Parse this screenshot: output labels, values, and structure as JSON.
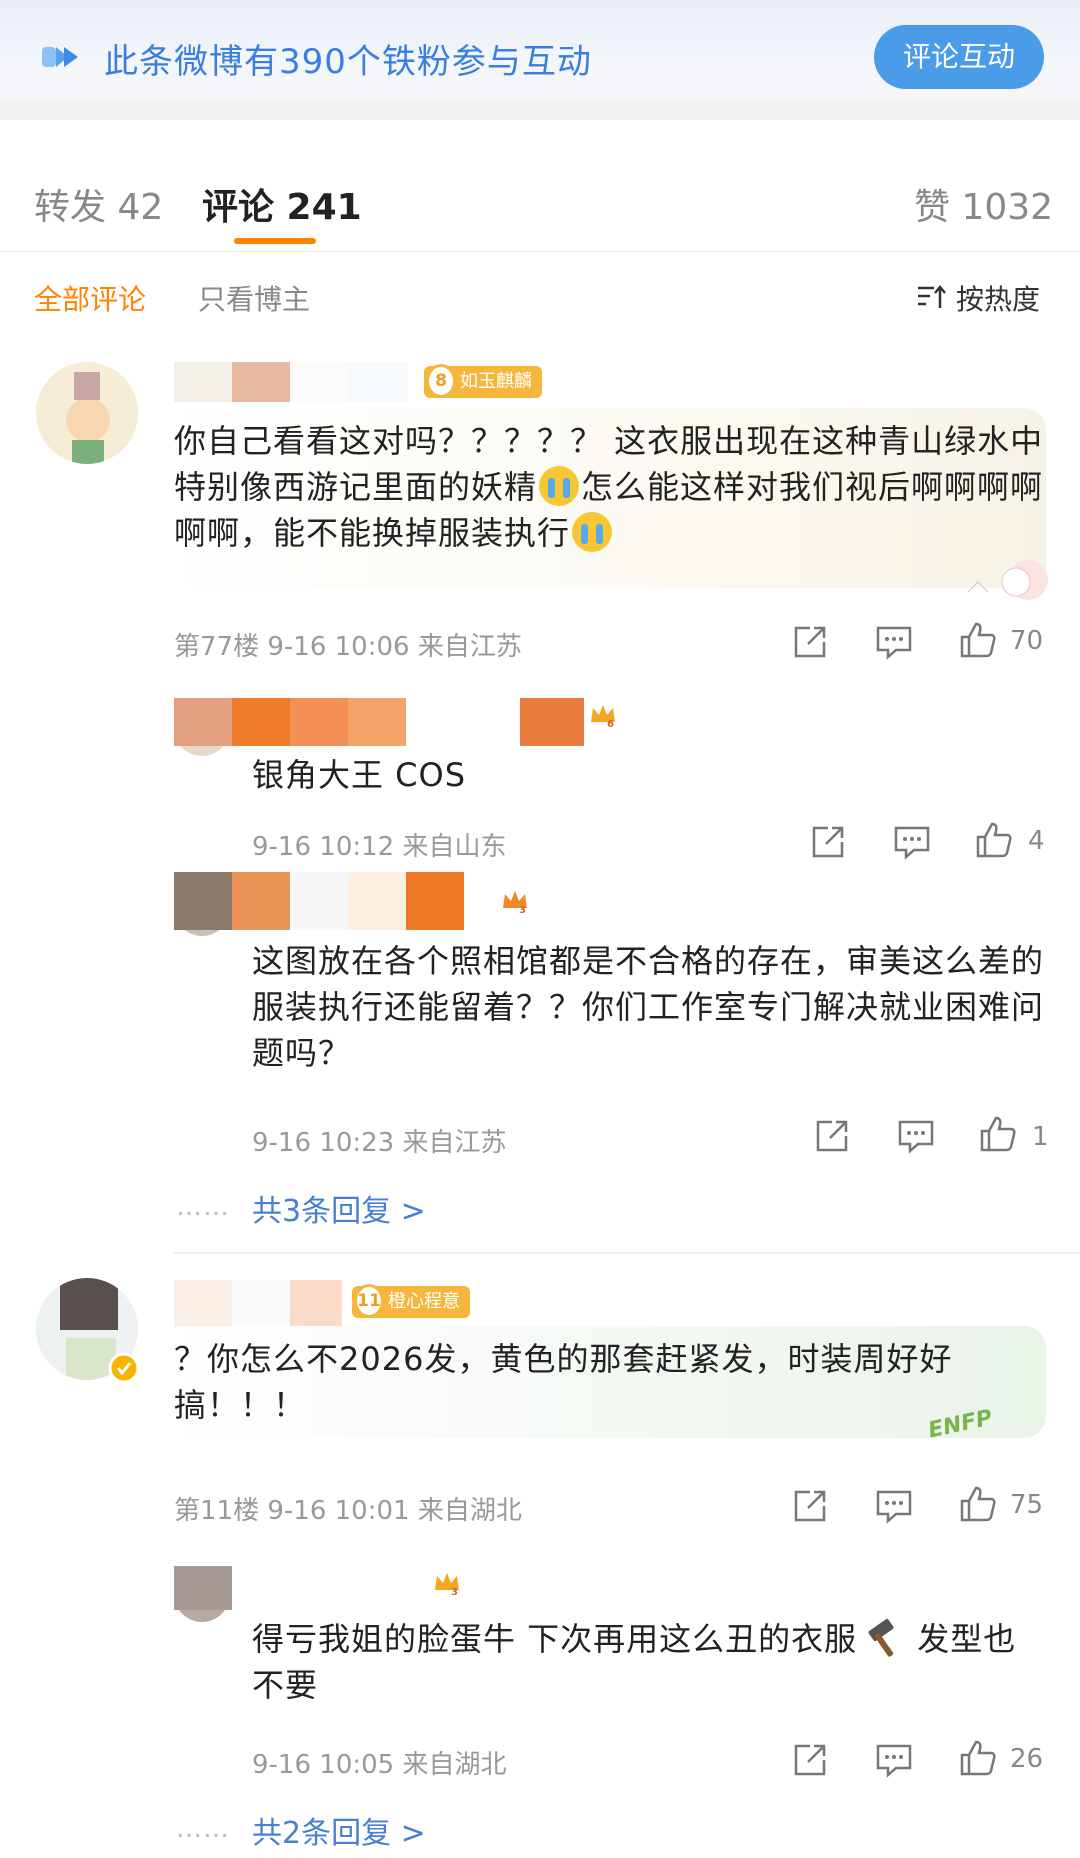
{
  "banner": {
    "text": "此条微博有390个铁粉参与互动",
    "button": "评论互动"
  },
  "tabs": {
    "repost": "转发 42",
    "comment": "评论 241",
    "like": "赞 1032"
  },
  "filter": {
    "all": "全部评论",
    "author_only": "只看博主",
    "sort": "按热度"
  },
  "comments": [
    {
      "badge_level": "8",
      "badge_text": "如玉麒麟",
      "text_parts": [
        "你自己看看这对吗？？？？？ 这衣服出现在这种青山绿水中特别像西游记里面的妖精",
        "怎么能这样对我们视后啊啊啊啊啊啊，能不能换掉服装执行"
      ],
      "meta": "第77楼  9-16 10:06  来自江苏",
      "likes": "70",
      "replies": [
        {
          "text": "银角大王 COS",
          "meta": "9-16 10:12  来自山东",
          "likes": "4",
          "crown_level": "6"
        },
        {
          "text": "这图放在各个照相馆都是不合格的存在，审美这么差的服装执行还能留着？？你们工作室专门解决就业困难问题吗？",
          "meta": "9-16 10:23  来自江苏",
          "likes": "1",
          "crown_level": "3"
        }
      ],
      "more_replies": "共3条回复 >"
    },
    {
      "badge_level": "11",
      "badge_text": "橙心程意",
      "text": "？你怎么不2026发，黄色的那套赶紧发，时装周好好搞！！！",
      "deco_text": "ENFP",
      "meta": "第11楼  9-16 10:01  来自湖北",
      "likes": "75",
      "replies": [
        {
          "text_parts": [
            "得亏我姐的脸蛋牛 下次再用这么丑的衣服",
            "发型也不要"
          ],
          "meta": "9-16 10:05  来自湖北",
          "likes": "26",
          "crown_level": "3"
        }
      ],
      "more_replies": "共2条回复 >"
    }
  ],
  "dots": "……",
  "colors": {
    "accent": "#ff8200",
    "link": "#4a7fd0",
    "banner_button": "#4a9be8"
  }
}
